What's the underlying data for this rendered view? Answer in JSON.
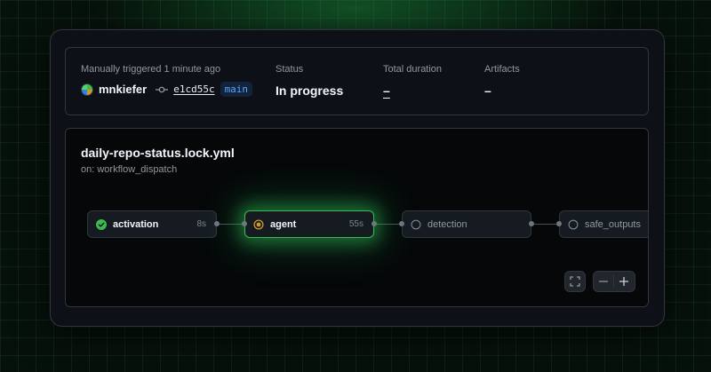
{
  "summary": {
    "trigger_label": "Manually triggered 1 minute ago",
    "user": "mnkiefer",
    "commit": "e1cd55c",
    "branch": "main",
    "status_label": "Status",
    "status_value": "In progress",
    "duration_label": "Total duration",
    "duration_value": "–",
    "artifacts_label": "Artifacts",
    "artifacts_value": "–"
  },
  "workflow": {
    "title": "daily-repo-status.lock.yml",
    "subtitle": "on: workflow_dispatch"
  },
  "jobs": [
    {
      "name": "activation",
      "duration": "8s",
      "status": "success",
      "icon": "check-circle-icon"
    },
    {
      "name": "agent",
      "duration": "55s",
      "status": "in_progress",
      "icon": "in-progress-icon"
    },
    {
      "name": "detection",
      "duration": "",
      "status": "pending",
      "icon": "pending-circle-icon"
    },
    {
      "name": "safe_outputs",
      "duration": "",
      "status": "pending",
      "icon": "pending-circle-icon"
    }
  ],
  "controls": {
    "fullscreen_icon": "fullscreen-icon",
    "zoom_out_icon": "zoom-out-icon",
    "zoom_in_icon": "zoom-in-icon"
  },
  "colors": {
    "success": "#3fb950",
    "in_progress": "#d29922",
    "pending": "#7d8590",
    "branch": "#58a6ff",
    "glow": "#2ec85a"
  }
}
